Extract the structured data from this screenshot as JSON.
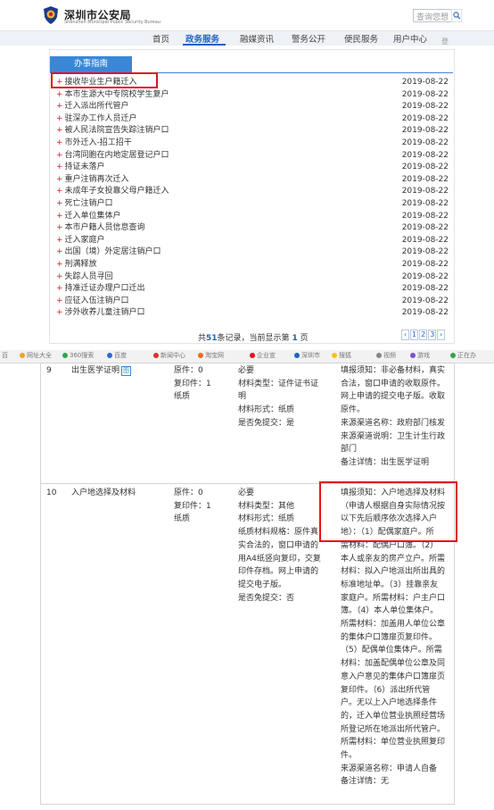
{
  "header": {
    "site_title": "深圳市公安局",
    "site_subtitle": "Shenzhen Municipal Public Security Bureau",
    "search_placeholder": "查询您想"
  },
  "nav": {
    "items": [
      "首页",
      "政务服务",
      "融媒资讯",
      "警务公开",
      "便民服务",
      "用户中心",
      "登"
    ],
    "active": "政务服务"
  },
  "guide": {
    "tab_label": "办事指南",
    "items": [
      {
        "title": "接收毕业生户籍迁入",
        "date": "2019-08-22"
      },
      {
        "title": "本市生源大中专院校学生复户",
        "date": "2019-08-22"
      },
      {
        "title": "迁入派出所代管户",
        "date": "2019-08-22"
      },
      {
        "title": "驻深办工作人员迁户",
        "date": "2019-08-22"
      },
      {
        "title": "被人民法院宣告失踪注销户口",
        "date": "2019-08-22"
      },
      {
        "title": "市外迁入-招工招干",
        "date": "2019-08-22"
      },
      {
        "title": "台湾同胞在内地定居登记户口",
        "date": "2019-08-22"
      },
      {
        "title": "持证未落户",
        "date": "2019-08-22"
      },
      {
        "title": "重户注销再次迁入",
        "date": "2019-08-22"
      },
      {
        "title": "未成年子女投靠父母户籍迁入",
        "date": "2019-08-22"
      },
      {
        "title": "死亡注销户口",
        "date": "2019-08-22"
      },
      {
        "title": "迁入单位集体户",
        "date": "2019-08-22"
      },
      {
        "title": "本市户籍人员信息查询",
        "date": "2019-08-22"
      },
      {
        "title": "迁入家庭户",
        "date": "2019-08-22"
      },
      {
        "title": "出国（境）外定居注销户口",
        "date": "2019-08-22"
      },
      {
        "title": "刑满释放",
        "date": "2019-08-22"
      },
      {
        "title": "失踪人员寻回",
        "date": "2019-08-22"
      },
      {
        "title": "持准迁证办理户口迁出",
        "date": "2019-08-22"
      },
      {
        "title": "应征入伍注销户口",
        "date": "2019-08-22"
      },
      {
        "title": "涉外收养儿童注销户口",
        "date": "2019-08-22"
      }
    ],
    "pager": {
      "prefix": "共",
      "total": "51",
      "middle": "条记录，当前显示第",
      "current": "1",
      "suffix": "页",
      "buttons": [
        "‹",
        "1",
        "2",
        "3",
        "›"
      ]
    }
  },
  "bookmarks": [
    "百",
    "网址大全",
    "360搜索",
    "百度",
    "新闻中心",
    "淘宝网",
    "企业宣",
    "深圳市",
    "搜狐",
    "视频",
    "游戏",
    "正在办"
  ],
  "table": {
    "rows": [
      {
        "index": "9",
        "name": "出生医学证明",
        "name_badge": "图",
        "copies": [
          "原件：0",
          "复印件：1",
          "纸质"
        ],
        "requirement": [
          "必要",
          "材料类型：证件证书证",
          "明",
          "材料形式：纸质",
          "是否免提交：是"
        ],
        "notes": [
          "填报须知：非必备材料，真实",
          "合法，窗口申请的收取原件。",
          "网上申请的提交电子版。收取",
          "原件。",
          "来源渠道名称：政府部门核发",
          "来源渠道说明：卫生计生行政",
          "部门",
          "备注详情：出生医学证明"
        ]
      },
      {
        "index": "10",
        "name": "入户地选择及材料",
        "copies": [
          "原件：0",
          "复印件：1",
          "纸质"
        ],
        "requirement": [
          "必要",
          "材料类型：其他",
          "材料形式：纸质",
          "纸质材料规格：原件真",
          "实合法的，窗口申请的",
          "用A4纸竖向复印，交复",
          "印件存档。网上申请的",
          "提交电子版。",
          "是否免提交：否"
        ],
        "notes": [
          "填报须知：入户地选择及材料",
          "（申请人根据自身实际情况按",
          "以下先后顺序依次选择入户",
          "地）：（1）配偶家庭户。所",
          "需材料：配偶户口簿。（2）",
          "本人或亲友的房产立户。所需",
          "材料：拟入户地派出所出具的",
          "标准地址单。（3）挂靠亲友",
          "家庭户。所需材料：户主户口",
          "簿。（4）本人单位集体户。",
          "所需材料：加盖用人单位公章",
          "的集体户口簿扉页复印件。",
          "（5）配偶单位集体户。所需",
          "材料：加盖配偶单位公章及同",
          "意入户意见的集体户口簿扉页",
          "复印件。（6）派出所代管",
          "户。无以上入户地选择条件",
          "的，迁入单位营业执照经营场",
          "所登记所在地派出所代管户。",
          "所需材料：单位营业执照复印",
          "件。",
          "来源渠道名称：申请人自备",
          "备注详情：无"
        ]
      }
    ]
  },
  "colors": {
    "accent_blue": "#3a87d8",
    "highlight_red": "#e0141b",
    "plus_red": "#c1272d"
  }
}
